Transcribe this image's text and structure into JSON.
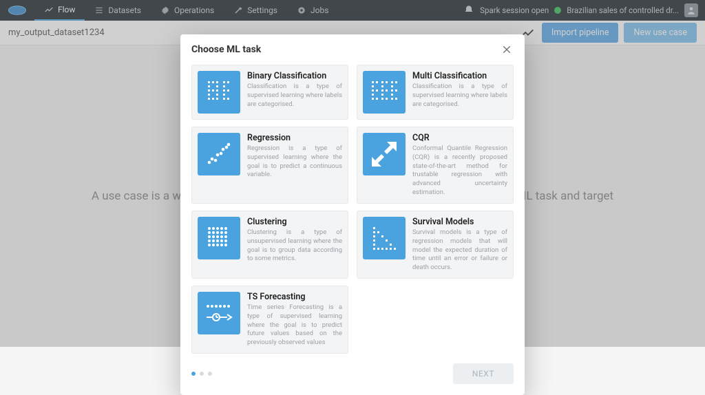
{
  "nav": {
    "items": [
      {
        "label": "Flow"
      },
      {
        "label": "Datasets"
      },
      {
        "label": "Operations"
      },
      {
        "label": "Settings"
      },
      {
        "label": "Jobs"
      }
    ]
  },
  "notif": {
    "spark": "Spark session open",
    "project": "Brazilian sales of controlled dr..."
  },
  "subheader": {
    "dataset_name": "my_output_dataset1234",
    "import_label": "Import pipeline",
    "new_label": "New use case"
  },
  "body_text": "A use case is a workspace where you can create pipelines and models for a given ML task and target",
  "modal": {
    "title": "Choose ML task",
    "next_label": "NEXT",
    "tasks": [
      {
        "title": "Binary Classification",
        "desc": "Classification is a type of supervised learning where labels are categorised."
      },
      {
        "title": "Multi Classification",
        "desc": "Classification is a type of supervised learning where labels are categorised."
      },
      {
        "title": "Regression",
        "desc": "Regression is a type of supervised learning where the goal is to predict a continuous variable."
      },
      {
        "title": "CQR",
        "desc": "Conformal Quantile Regression (CQR) is a recently proposed state-of-the-art method for trustable regression with advanced uncertainty estimation."
      },
      {
        "title": "Clustering",
        "desc": "Clustering is a type of unsupervised learning where the goal is to group data according to some metrics."
      },
      {
        "title": "Survival Models",
        "desc": "Survival models is a type of regression models that will model the expected duration of time until an error or failure or death occurs."
      },
      {
        "title": "TS Forecasting",
        "desc": "Time series Forecasting is a type of supervised learning where the goal is to predict future values based on the previously observed values"
      }
    ]
  }
}
